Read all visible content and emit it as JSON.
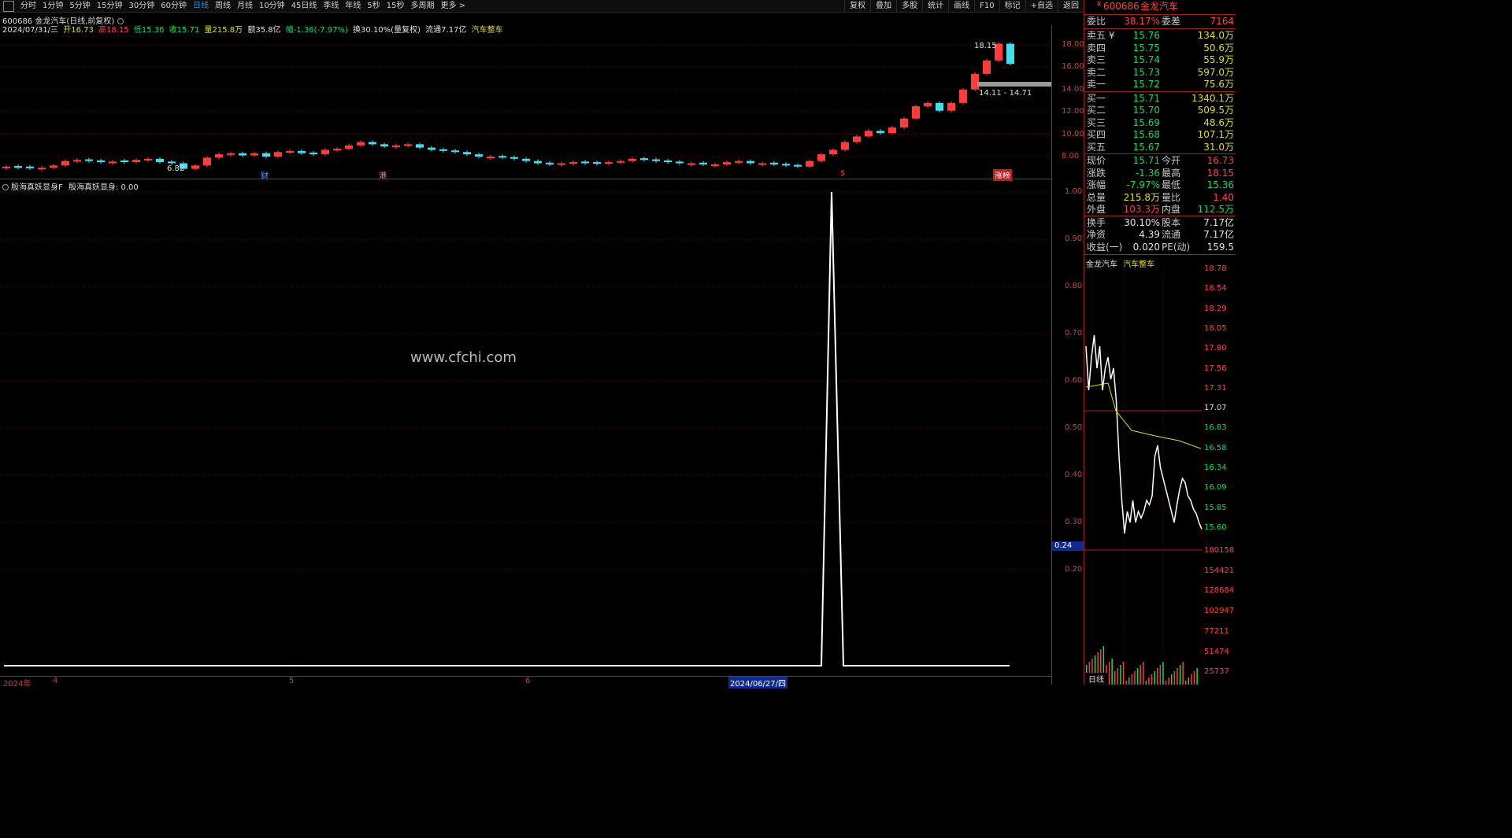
{
  "toolbar": {
    "left": [
      "分时",
      "1分钟",
      "5分钟",
      "15分钟",
      "30分钟",
      "60分钟",
      "日线",
      "周线",
      "月线",
      "10分钟",
      "45日线",
      "季线",
      "年线",
      "5秒",
      "15秒",
      "多周期",
      "更多 >"
    ],
    "active": "日线",
    "right": [
      "复权",
      "叠加",
      "多股",
      "统计",
      "画线",
      "F10",
      "标记",
      "+自选",
      "返回"
    ]
  },
  "chart": {
    "title": "600686 金龙汽车(日线,前复权)",
    "info": {
      "date": "2024/07/31/三",
      "open": "开16.73",
      "high": "高18.15",
      "low": "低15.36",
      "close": "收15.71",
      "vol": "量215.8万",
      "amount": "额35.8亿",
      "change": "幅-1.36(-7.97%)",
      "turnover": "换30.10%(量复权)",
      "float": "流通7.17亿",
      "sector": "汽车整车"
    },
    "price_axis": [
      "18.00",
      "16.00",
      "14.00",
      "12.00",
      "10.00",
      "8.00"
    ],
    "high_label": "18.15",
    "low_label": "6.82",
    "band_label": "14.11 - 14.71",
    "event_markers": [
      "财",
      "港",
      "$",
      "涨榜"
    ],
    "watermark": "www.cfchi.com",
    "indicator_title": "殷海真妖显身F",
    "indicator_value": "殷海真妖显身: 0.00",
    "indicator_axis": [
      "1.00",
      "0.90",
      "0.80",
      "0.70",
      "0.60",
      "0.50",
      "0.40",
      "0.30",
      "0.20"
    ],
    "indicator_current": "0.24",
    "date_axis": [
      "2024年",
      "4",
      "5",
      "6",
      "2024/06/27/四"
    ]
  },
  "chart_data": {
    "type": "candlestick",
    "indicator": {
      "name": "殷海真妖显身",
      "peak": 1.0,
      "baseline": 0.0
    }
  },
  "panel": {
    "code": "600686",
    "name": "金龙汽车",
    "ratio": {
      "label": "委比",
      "value": "38.17%",
      "label2": "委差",
      "value2": "7164"
    },
    "asks": [
      {
        "label": "卖五 ¥",
        "price": "15.76",
        "vol": "134.0万"
      },
      {
        "label": "卖四",
        "price": "15.75",
        "vol": "50.6万"
      },
      {
        "label": "卖三",
        "price": "15.74",
        "vol": "55.9万"
      },
      {
        "label": "卖二",
        "price": "15.73",
        "vol": "597.0万"
      },
      {
        "label": "卖一",
        "price": "15.72",
        "vol": "75.6万"
      }
    ],
    "bids": [
      {
        "label": "买一",
        "price": "15.71",
        "vol": "1340.1万"
      },
      {
        "label": "买二",
        "price": "15.70",
        "vol": "509.5万"
      },
      {
        "label": "买三",
        "price": "15.69",
        "vol": "48.6万"
      },
      {
        "label": "买四",
        "price": "15.68",
        "vol": "107.1万"
      },
      {
        "label": "买五",
        "price": "15.67",
        "vol": "31.0万"
      }
    ],
    "quote": [
      {
        "l1": "现价",
        "v1": "15.71",
        "l2": "今开",
        "v2": "16.73"
      },
      {
        "l1": "涨跌",
        "v1": "-1.36",
        "l2": "最高",
        "v2": "18.15"
      },
      {
        "l1": "涨幅",
        "v1": "-7.97%",
        "l2": "最低",
        "v2": "15.36"
      },
      {
        "l1": "总量",
        "v1": "215.8万",
        "l2": "量比",
        "v2": "1.40"
      },
      {
        "l1": "外盘",
        "v1": "103.3万",
        "l2": "内盘",
        "v2": "112.5万"
      }
    ],
    "fund": [
      {
        "l1": "换手",
        "v1": "30.10%",
        "l2": "股本",
        "v2": "7.17亿"
      },
      {
        "l1": "净资",
        "v1": "4.39",
        "l2": "流通",
        "v2": "7.17亿"
      },
      {
        "l1": "收益(一)",
        "v1": "0.020",
        "l2": "PE(动)",
        "v2": "159.5"
      }
    ],
    "mini_title": "金龙汽车",
    "mini_sector": "汽车整车",
    "mini_price_axis": [
      "18.78",
      "18.54",
      "18.29",
      "18.05",
      "17.80",
      "17.56",
      "17.31",
      "17.07",
      "16.83",
      "16.58",
      "16.34",
      "16.09",
      "15.85",
      "15.60"
    ],
    "mini_vol_axis": [
      "180158",
      "154421",
      "128684",
      "102947",
      "77211",
      "51474",
      "25737"
    ],
    "bottom_label": "日线"
  }
}
